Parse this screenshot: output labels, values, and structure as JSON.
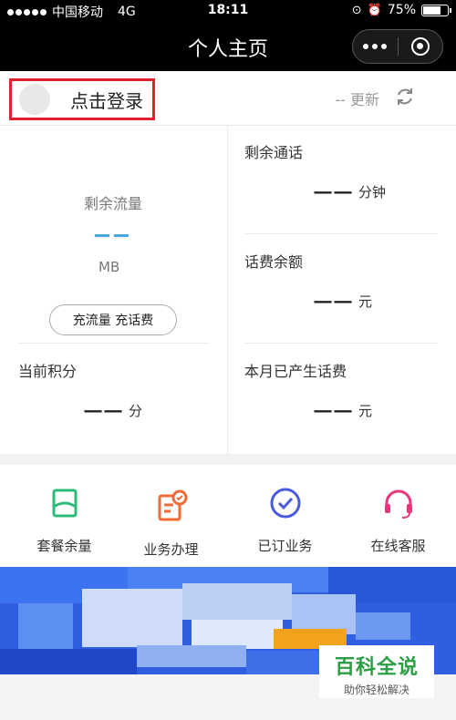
{
  "status_bar": {
    "carrier": "中国移动",
    "network": "4G",
    "time": "18:11",
    "battery": "75%",
    "battery_level": 0.75
  },
  "nav": {
    "title": "个人主页"
  },
  "login": {
    "label": "点击登录",
    "update_text": "-- 更新"
  },
  "stats": {
    "flow": {
      "label": "剩余流量",
      "unit": "MB",
      "button_label": "充流量 充话费"
    },
    "call_minutes": {
      "label": "剩余通话",
      "value": "一一",
      "unit": "分钟"
    },
    "balance": {
      "label": "话费余额",
      "value": "一一",
      "unit": "元"
    },
    "points": {
      "label": "当前积分",
      "value": "一一",
      "unit": "分"
    },
    "monthly_fee": {
      "label": "本月已产生话费",
      "value": "一一",
      "unit": "元"
    }
  },
  "services": [
    {
      "label": "套餐余量",
      "icon": "package-icon",
      "color": "#2dbb7a"
    },
    {
      "label": "业务办理",
      "icon": "service-form-icon",
      "color": "#f06a35"
    },
    {
      "label": "已订业务",
      "icon": "check-circle-icon",
      "color": "#4a5be0"
    },
    {
      "label": "在线客服",
      "icon": "headset-icon",
      "color": "#e8377a"
    }
  ],
  "watermark": {
    "main": "百科全说",
    "sub": "助你轻松解决"
  },
  "colors": {
    "highlight_border": "#e0202c",
    "flow_accent": "#4aa8e8",
    "banner_blue": "#2f5ee0"
  }
}
